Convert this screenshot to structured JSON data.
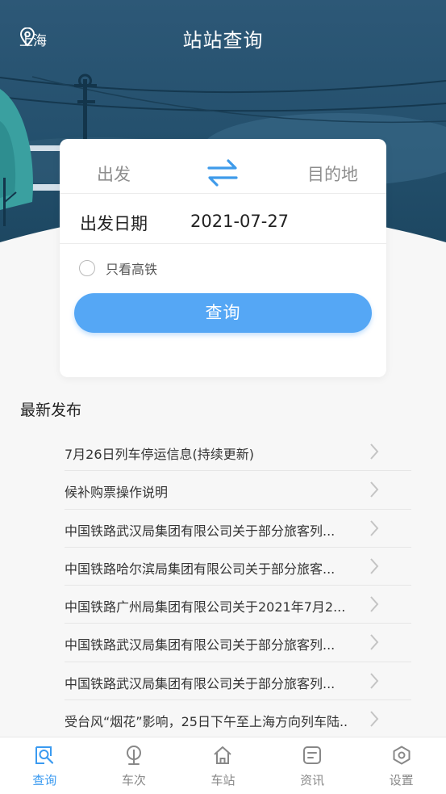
{
  "header": {
    "location": "上海",
    "title": "站站查询"
  },
  "search_card": {
    "from_label": "出发",
    "to_label": "目的地",
    "date_label": "出发日期",
    "date_value": "2021-07-27",
    "high_speed_only_label": "只看高铁",
    "high_speed_only_checked": false,
    "search_button_label": "查询"
  },
  "news": {
    "heading": "最新发布",
    "items": [
      {
        "title": "7月26日列车停运信息(持续更新)"
      },
      {
        "title": "候补购票操作说明"
      },
      {
        "title": "中国铁路武汉局集团有限公司关于部分旅客列..."
      },
      {
        "title": "中国铁路哈尔滨局集团有限公司关于部分旅客..."
      },
      {
        "title": "中国铁路广州局集团有限公司关于2021年7月2..."
      },
      {
        "title": "中国铁路武汉局集团有限公司关于部分旅客列..."
      },
      {
        "title": "中国铁路武汉局集团有限公司关于部分旅客列..."
      },
      {
        "title": "受台风“烟花”影响，25日下午至上海方向列车陆..."
      }
    ]
  },
  "tabbar": {
    "tabs": [
      {
        "label": "查询",
        "icon": "search-doc-icon",
        "active": true
      },
      {
        "label": "车次",
        "icon": "train-icon",
        "active": false
      },
      {
        "label": "车站",
        "icon": "home-icon",
        "active": false
      },
      {
        "label": "资讯",
        "icon": "news-icon",
        "active": false
      },
      {
        "label": "设置",
        "icon": "settings-icon",
        "active": false
      }
    ]
  },
  "colors": {
    "accent": "#3a9af0",
    "button": "#55a7f5",
    "header_dark": "#1f4762"
  }
}
